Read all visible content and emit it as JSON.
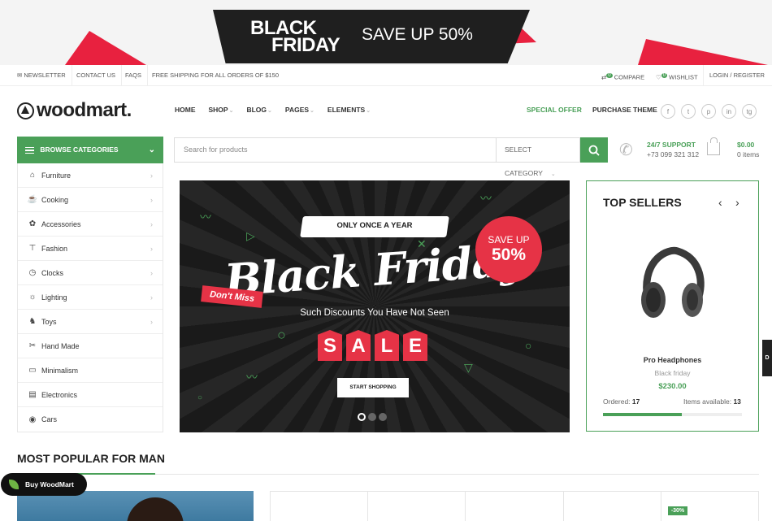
{
  "promo": {
    "line1": "BLACK",
    "line2": "FRIDAY",
    "save": "SAVE UP 50%"
  },
  "topbar": {
    "newsletter": "NEWSLETTER",
    "contact": "CONTACT US",
    "faqs": "FAQS",
    "shipping": "FREE SHIPPING FOR ALL ORDERS OF $150",
    "compare": "COMPARE",
    "compare_count": "0",
    "wishlist": "WISHLIST",
    "wishlist_count": "0",
    "login": "LOGIN / REGISTER"
  },
  "header": {
    "logo": "woodmart.",
    "nav": [
      "HOME",
      "SHOP",
      "BLOG",
      "PAGES",
      "ELEMENTS"
    ],
    "special": "SPECIAL OFFER",
    "purchase": "PURCHASE THEME",
    "socials": [
      "f",
      "t",
      "p",
      "in",
      "tg"
    ]
  },
  "categories": {
    "title": "BROWSE CATEGORIES",
    "items": [
      {
        "label": "Furniture",
        "icon": "chair-icon",
        "arrow": true
      },
      {
        "label": "Cooking",
        "icon": "cooking-icon",
        "arrow": true
      },
      {
        "label": "Accessories",
        "icon": "accessories-icon",
        "arrow": true
      },
      {
        "label": "Fashion",
        "icon": "shirt-icon",
        "arrow": true
      },
      {
        "label": "Clocks",
        "icon": "clock-icon",
        "arrow": true
      },
      {
        "label": "Lighting",
        "icon": "lamp-icon",
        "arrow": true
      },
      {
        "label": "Toys",
        "icon": "toy-icon",
        "arrow": true
      },
      {
        "label": "Hand Made",
        "icon": "handmade-icon",
        "arrow": false
      },
      {
        "label": "Minimalism",
        "icon": "minimalism-icon",
        "arrow": false
      },
      {
        "label": "Electronics",
        "icon": "electronics-icon",
        "arrow": false
      },
      {
        "label": "Cars",
        "icon": "car-icon",
        "arrow": false
      }
    ]
  },
  "search": {
    "placeholder": "Search for products",
    "category": "SELECT CATEGORY"
  },
  "support": {
    "title": "24/7 SUPPORT",
    "phone": "+73 099 321 312"
  },
  "cart": {
    "total": "$0.00",
    "items": "0 items"
  },
  "hero": {
    "once": "ONLY ONCE A YEAR",
    "title": "Black Friday",
    "dont_miss": "Don't Miss",
    "save_a": "SAVE UP",
    "save_b": "50%",
    "subtitle": "Such Discounts You Have Not Seen",
    "sale": [
      "S",
      "A",
      "L",
      "E"
    ],
    "button": "START SHOPPING",
    "slides": 3,
    "active_slide": 1
  },
  "top_sellers": {
    "title": "TOP SELLERS",
    "product_name": "Pro Headphones",
    "product_category": "Black friday",
    "price": "$230.00",
    "ordered_label": "Ordered:",
    "ordered": "17",
    "available_label": "Items available:",
    "available": "13",
    "sold_fraction": 0.57
  },
  "side_tab": "D",
  "popular": {
    "title": "MOST POPULAR FOR MAN",
    "discount": "-30%"
  },
  "buy_button": "Buy WoodMart",
  "colors": {
    "accent": "#4aa058",
    "red": "#e63346",
    "dark": "#1d1d1d"
  }
}
